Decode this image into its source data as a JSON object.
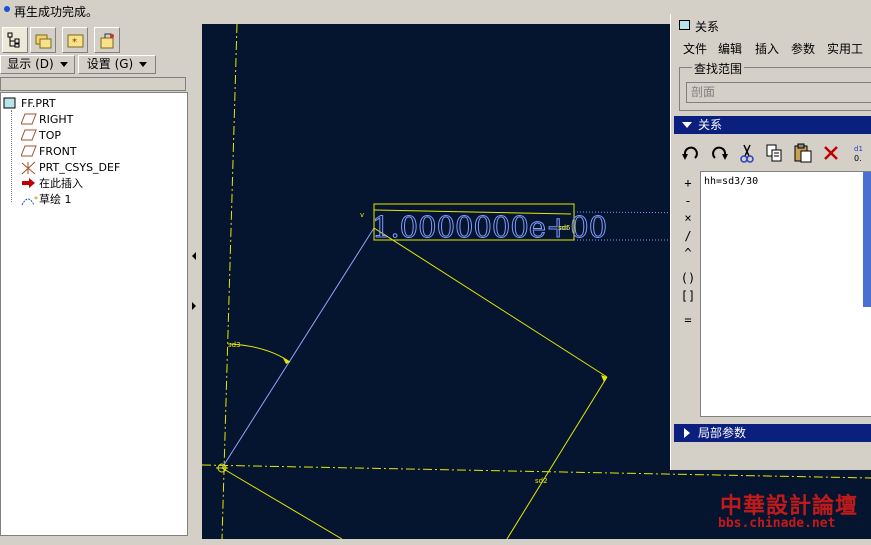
{
  "status": {
    "message": "再生成功完成。"
  },
  "left_panel": {
    "tabs": [
      {
        "name": "model-tree-tab",
        "icon": "model-tree-icon",
        "active": true
      },
      {
        "name": "folder-browser-tab",
        "icon": "folder-browser-icon"
      },
      {
        "name": "favorites-tab",
        "icon": "favorites-icon"
      },
      {
        "name": "connections-tab",
        "icon": "connections-icon"
      }
    ],
    "show_label": "显示 (D)",
    "settings_label": "设置 (G)",
    "tree": [
      {
        "label": "FF.PRT",
        "icon": "part-icon"
      },
      {
        "label": "RIGHT",
        "icon": "datum-plane-icon"
      },
      {
        "label": "TOP",
        "icon": "datum-plane-icon"
      },
      {
        "label": "FRONT",
        "icon": "datum-plane-icon"
      },
      {
        "label": "PRT_CSYS_DEF",
        "icon": "coordinate-system-icon"
      },
      {
        "label": "在此插入",
        "icon": "insert-here-arrow-icon"
      },
      {
        "label": "草绘 1",
        "icon": "sketch-icon"
      }
    ]
  },
  "canvas": {
    "dimension_text": "1.0000000e+00",
    "dim_labels": {
      "sd3": "sd3",
      "sd5": "sd5",
      "sd2": "sd2",
      "v": "v"
    },
    "colors": {
      "background": "#06152f",
      "sketch": "#e6e600",
      "line": "#8fa3ff",
      "dim_text": "#7f9bff"
    }
  },
  "relations_dialog": {
    "title": "关系",
    "menu": [
      "文件",
      "编辑",
      "插入",
      "参数",
      "实用工"
    ],
    "look_in_label": "查找范围",
    "look_in_value": "剖面",
    "relations_section": "关系",
    "toolbar": [
      "undo-icon",
      "redo-icon",
      "cut-icon",
      "copy-icon",
      "paste-icon",
      "delete-icon",
      "evaluate-icon"
    ],
    "operators": [
      "+",
      "-",
      "×",
      "/",
      "^",
      "()",
      "[]",
      "="
    ],
    "relation_text": "hh=sd3/30",
    "local_params_label": "局部参数"
  },
  "watermark": {
    "cn": "中華設計論壇",
    "en": "bbs.chinade.net"
  }
}
